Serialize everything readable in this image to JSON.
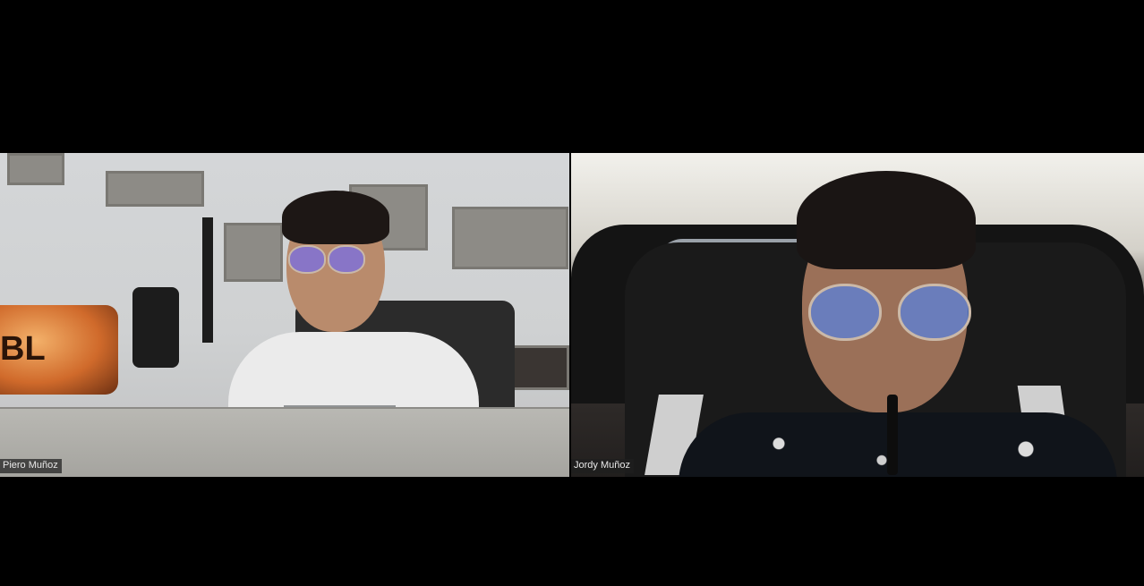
{
  "meeting": {
    "participants": [
      {
        "name": "Piero Muñoz"
      },
      {
        "name": "Jordy Muñoz"
      }
    ]
  },
  "scene": {
    "speaker_brand": "BL"
  }
}
